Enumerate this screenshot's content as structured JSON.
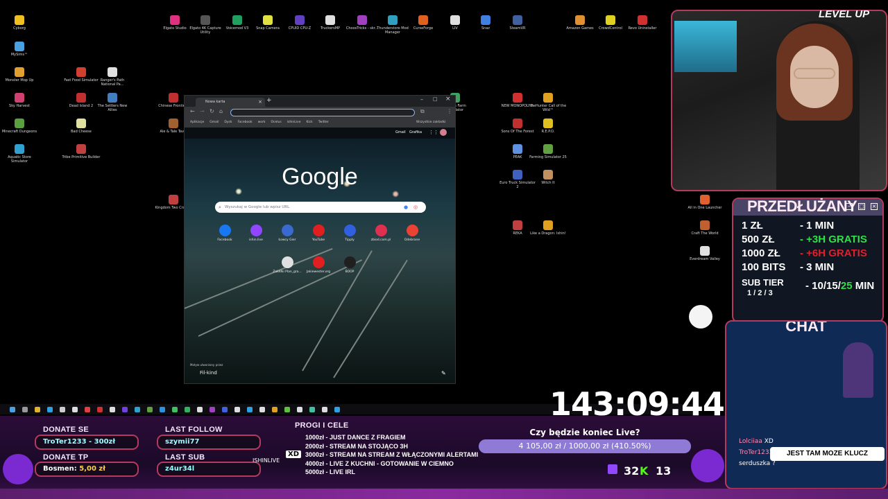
{
  "desktop": {
    "icons": [
      {
        "label": "Cyborg",
        "color": "#f0c020"
      },
      {
        "label": "MySims™",
        "color": "#4aa0e0"
      },
      {
        "label": "Monster Mop Up",
        "color": "#e0a030"
      },
      {
        "label": "Sky Harvest",
        "color": "#d04070"
      },
      {
        "label": "Minecraft Dungeons",
        "color": "#5aa040"
      },
      {
        "label": "Aquatic Store Simulator",
        "color": "#30a0d0"
      },
      {
        "label": "Fast Food Simulator",
        "color": "#d04030"
      },
      {
        "label": "Dead Island 2",
        "color": "#c03030"
      },
      {
        "label": "Bad Cheese",
        "color": "#e0e0a0"
      },
      {
        "label": "Tribe Primitive Builder",
        "color": "#c04040"
      },
      {
        "label": "Ranger's Path National Pa...",
        "color": "#e0e0e0"
      },
      {
        "label": "The Settlers New Allies",
        "color": "#4080c0"
      },
      {
        "label": "Chinese Frontie...",
        "color": "#c03030"
      },
      {
        "label": "Ale & Tale Tav...",
        "color": "#a06030"
      },
      {
        "label": "Kingdom Two Crowns",
        "color": "#c04040"
      },
      {
        "label": "Elgato Studio",
        "color": "#e03080"
      },
      {
        "label": "Elgato 4K Capture Utility",
        "color": "#555555"
      },
      {
        "label": "Voicemod V3",
        "color": "#20a060"
      },
      {
        "label": "Snap Camera",
        "color": "#e0e040"
      },
      {
        "label": "CPUID CPU-Z",
        "color": "#6040c0"
      },
      {
        "label": "TruckersMP",
        "color": "#e0e0e0"
      },
      {
        "label": "ChoosTricks - skr...",
        "color": "#a040c0"
      },
      {
        "label": "Thunderstore Mod Manager",
        "color": "#30a0c0"
      },
      {
        "label": "CurseForge",
        "color": "#e06020"
      },
      {
        "label": "LIV",
        "color": "#e0e0e0"
      },
      {
        "label": "Snaz",
        "color": "#4080e0"
      },
      {
        "label": "SteamVR",
        "color": "#4060a0"
      },
      {
        "label": "Amazon Games",
        "color": "#e09030"
      },
      {
        "label": "CrowdControl",
        "color": "#e0d020"
      },
      {
        "label": "Revo Uninstaller",
        "color": "#d03030"
      },
      {
        "label": "...onics Farm Simulator",
        "color": "#40a060"
      },
      {
        "label": "NEW MONOPOLY®",
        "color": "#d03030"
      },
      {
        "label": "theHunter Call of the Wild™",
        "color": "#e0a020"
      },
      {
        "label": "Sons Of The Forest",
        "color": "#c03030"
      },
      {
        "label": "R.E.P.O.",
        "color": "#e0c020"
      },
      {
        "label": "PEAK",
        "color": "#6090e0"
      },
      {
        "label": "Farming Simulator 25",
        "color": "#60a040"
      },
      {
        "label": "Euro Truck Simulator 2",
        "color": "#4060c0"
      },
      {
        "label": "Witch It",
        "color": "#c09060"
      },
      {
        "label": "REKA",
        "color": "#c04040"
      },
      {
        "label": "Like a Dragon: Ishin!",
        "color": "#e0a020"
      },
      {
        "label": "All in One Launcher",
        "color": "#e06030"
      },
      {
        "label": "Craft The World",
        "color": "#c06030"
      },
      {
        "label": "Everdream Valley",
        "color": "#e0e0e0"
      }
    ]
  },
  "browser": {
    "tab_label": "Nowa karta",
    "omnibox_value": "",
    "bookmarks": [
      "Aplikacje",
      "Gmail",
      "Dysk",
      "Facebook",
      "work",
      "Ocelus",
      "ishinLive",
      "Kick",
      "Twitter"
    ],
    "all_bookmarks": "Wszystkie zakładki",
    "top_links": [
      "Gmail",
      "Grafika"
    ],
    "logo": "Google",
    "search_placeholder": "Wyszukaj w Google lub wpisz URL",
    "shortcuts_row1": [
      {
        "label": "Facebook",
        "color": "#1877f2"
      },
      {
        "label": "ishin.live",
        "color": "#9146ff"
      },
      {
        "label": "Łowcy Gier",
        "color": "#3a6ad0"
      },
      {
        "label": "YouTube",
        "color": "#e02020"
      },
      {
        "label": "Tipply",
        "color": "#3060e0"
      },
      {
        "label": "zbiod.com.pl",
        "color": "#e03050"
      },
      {
        "label": "Odebrane",
        "color": "#ea4335"
      }
    ],
    "shortcuts_row2": [
      {
        "label": "Zakłdki Plan_gra...",
        "color": "#e0e0e0"
      },
      {
        "label": "Jakiewester.org",
        "color": "#e02020"
      },
      {
        "label": "BOOP",
        "color": "#202020"
      }
    ],
    "bg_credit_small": "Motyw utworzony przez",
    "bg_credit": "Fil-kind"
  },
  "taskbar": {
    "colors": [
      "#4aa0e0",
      "#999",
      "#e0b030",
      "#30a0e0",
      "#ccc",
      "#ddd",
      "#e04040",
      "#d03030",
      "#ddd",
      "#7040e0",
      "#30a0d0",
      "#60a040",
      "#3090e0",
      "#40c060",
      "#30b060",
      "#ddd",
      "#a040c0",
      "#4060e0",
      "#ddd",
      "#30a0e0",
      "#ddd",
      "#e0a020",
      "#60c040",
      "#ddd",
      "#40c0a0",
      "#ddd",
      "#30a0e0"
    ]
  },
  "overlay": {
    "donate_se_title": "DONATE SE",
    "donate_se_value": "TroTer1233 - 300zł",
    "donate_tp_title": "DONATE TP",
    "donate_tp_name": "Bosmen:",
    "donate_tp_amount": "5,00 zł",
    "last_follow_title": "LAST FOLLOW",
    "last_follow_value": "szymii77",
    "last_sub_title": "LAST SUB",
    "last_sub_value": "z4ur34l",
    "progi_title": "PROGI I CELE",
    "progi": [
      "1000zł - JUST DANCE Z FRAGIEM",
      "2000zł - STREAM NA STOJĄCO 3H",
      "3000zł - STREAM NA STREAM Z WŁĄCZONYMI ALERTAMI",
      "4000zł - LIVE Z KUCHNI - GOTOWANIE W CIEMNO",
      "5000zł - LIVE IRL"
    ],
    "timer": "143:09:44",
    "live_question": "Czy będzie koniec Live?",
    "live_bar_text": "4 105,00 zł / 1000,00 zł (410.50%)",
    "live_bar_percent": 100,
    "viewers_twitch": "32",
    "viewers_kick": "13",
    "ishinlive_tag": "ISHINLIVE",
    "xd_tag": "XD"
  },
  "webcam": {
    "brand": "LEVEL UP"
  },
  "subathon": {
    "title": "PRZEDŁUŻANY",
    "rows": [
      {
        "left": "1 ZŁ",
        "right": "- 1 MIN",
        "style": ""
      },
      {
        "left": "500 ZŁ",
        "right": "- +3H GRATIS",
        "style": "green"
      },
      {
        "left": "1000 ZŁ",
        "right": "- +6H GRATIS",
        "style": "red"
      },
      {
        "left": "100 BITS",
        "right": "- 3 MIN",
        "style": ""
      }
    ],
    "sub_tier": "SUB TIER",
    "sub_tier_levels": "1 / 2 / 3",
    "sub_tier_values_a": "- 10/15/",
    "sub_tier_values_b": "25",
    "sub_tier_values_c": " MIN"
  },
  "chat": {
    "title": "CHAT",
    "messages": [
      {
        "user": "Lolciiaa",
        "text": "XD"
      },
      {
        "user": "TroTer1233",
        "text": ""
      },
      {
        "user": "",
        "text": "serduszka ?"
      }
    ],
    "bubble": "JEST TAM MOZE KLUCZ"
  }
}
